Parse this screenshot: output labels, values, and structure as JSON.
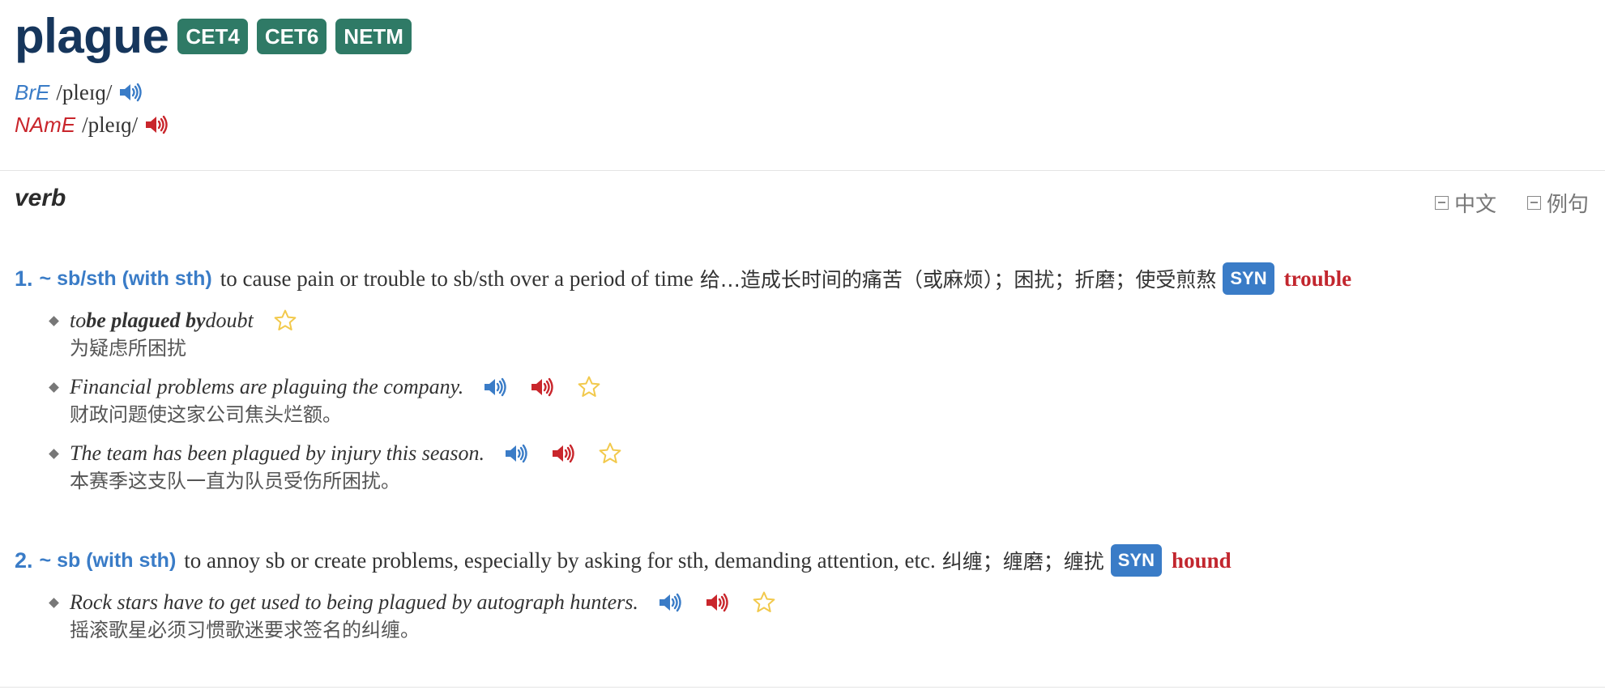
{
  "entry": {
    "headword": "plague",
    "tags": [
      "CET4",
      "CET6",
      "NETM"
    ],
    "pron": {
      "bre_label": "BrE",
      "bre_ipa": "/pleɪɡ/",
      "name_label": "NAmE",
      "name_ipa": "/pleɪɡ/"
    }
  },
  "section": {
    "pos": "verb",
    "toggle_chinese": "中文",
    "toggle_examples": "例句"
  },
  "senses": [
    {
      "num": "1.",
      "pattern": "~ sb/sth (with sth)",
      "definition": "to cause pain or trouble to sb/sth over a period of time",
      "definition_zh": "给…造成长时间的痛苦（或麻烦）；困扰；折磨；使受煎熬",
      "syn_label": "SYN",
      "syn_word": "trouble",
      "examples": [
        {
          "en_pre": "to ",
          "en_bold": "be plagued by",
          "en_post": " doubt",
          "zh": "为疑虑所困扰",
          "has_audio": false
        },
        {
          "en_pre": "Financial problems are plaguing the company.",
          "en_bold": "",
          "en_post": "",
          "zh": "财政问题使这家公司焦头烂额。",
          "has_audio": true
        },
        {
          "en_pre": "The team has been plagued by injury this season.",
          "en_bold": "",
          "en_post": "",
          "zh": "本赛季这支队一直为队员受伤所困扰。",
          "has_audio": true
        }
      ]
    },
    {
      "num": "2.",
      "pattern": "~ sb (with sth)",
      "definition": "to annoy sb or create problems, especially by asking for sth, demanding attention, etc.",
      "definition_zh": "纠缠；缠磨；缠扰",
      "syn_label": "SYN",
      "syn_word": "hound",
      "examples": [
        {
          "en_pre": "Rock stars have to get used to being plagued by autograph hunters.",
          "en_bold": "",
          "en_post": "",
          "zh": "摇滚歌星必须习惯歌迷要求签名的纠缠。",
          "has_audio": true
        }
      ]
    }
  ],
  "colors": {
    "headword": "#16365c",
    "tag_bg": "#2f7a66",
    "bre": "#3a7cc7",
    "name": "#c9262c",
    "syn_bg": "#3a7cc7",
    "syn_word": "#c2262e",
    "star": "#f2c94c"
  },
  "icons": {
    "bre_audio": "speaker-blue-icon",
    "name_audio": "speaker-red-icon",
    "favorite": "star-outline-icon",
    "toggle": "collapse-box-icon"
  }
}
